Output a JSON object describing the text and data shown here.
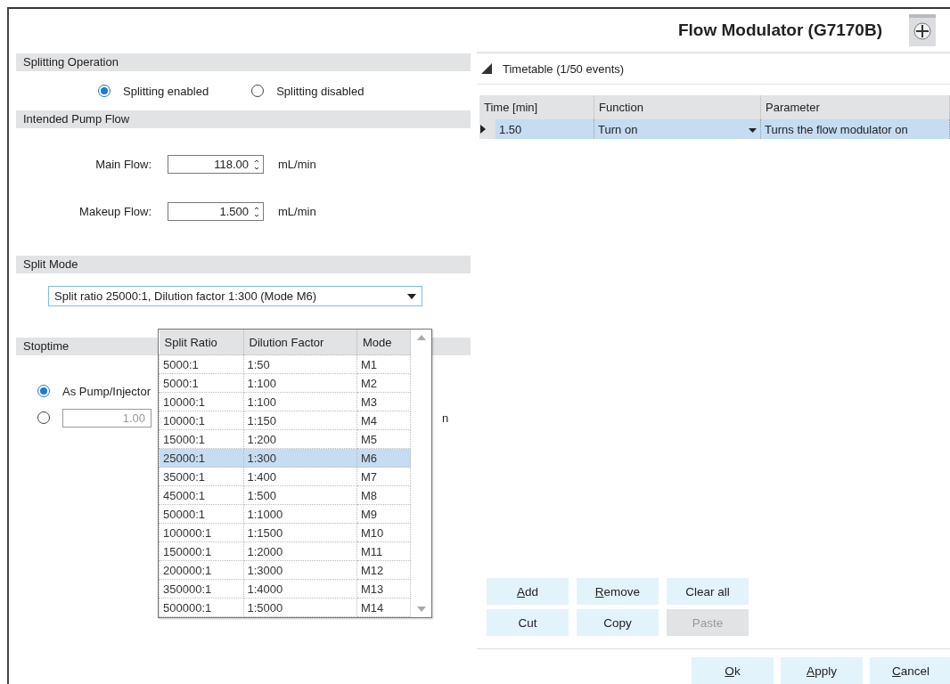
{
  "title": "Flow Modulator (G7170B)",
  "splitting_operation": {
    "heading": "Splitting Operation",
    "options": [
      {
        "label": "Splitting enabled",
        "selected": true
      },
      {
        "label": "Splitting disabled",
        "selected": false
      }
    ]
  },
  "intended_pump_flow": {
    "heading": "Intended Pump Flow",
    "fields": [
      {
        "label": "Main Flow:",
        "value": "118.00",
        "unit": "mL/min"
      },
      {
        "label": "Makeup Flow:",
        "value": "1.500",
        "unit": "mL/min"
      }
    ]
  },
  "split_mode": {
    "heading": "Split Mode",
    "value": "Split ratio 25000:1, Dilution factor 1:300 (Mode M6)",
    "columns": [
      "Split Ratio",
      "Dilution Factor",
      "Mode"
    ],
    "rows": [
      {
        "cells": [
          "5000:1",
          "1:50",
          "M1"
        ],
        "selected": false
      },
      {
        "cells": [
          "5000:1",
          "1:100",
          "M2"
        ],
        "selected": false
      },
      {
        "cells": [
          "10000:1",
          "1:100",
          "M3"
        ],
        "selected": false
      },
      {
        "cells": [
          "10000:1",
          "1:150",
          "M4"
        ],
        "selected": false
      },
      {
        "cells": [
          "15000:1",
          "1:200",
          "M5"
        ],
        "selected": false
      },
      {
        "cells": [
          "25000:1",
          "1:300",
          "M6"
        ],
        "selected": true
      },
      {
        "cells": [
          "35000:1",
          "1:400",
          "M7"
        ],
        "selected": false
      },
      {
        "cells": [
          "45000:1",
          "1:500",
          "M8"
        ],
        "selected": false
      },
      {
        "cells": [
          "50000:1",
          "1:1000",
          "M9"
        ],
        "selected": false
      },
      {
        "cells": [
          "100000:1",
          "1:1500",
          "M10"
        ],
        "selected": false
      },
      {
        "cells": [
          "150000:1",
          "1:2000",
          "M11"
        ],
        "selected": false
      },
      {
        "cells": [
          "200000:1",
          "1:3000",
          "M12"
        ],
        "selected": false
      },
      {
        "cells": [
          "350000:1",
          "1:4000",
          "M13"
        ],
        "selected": false
      },
      {
        "cells": [
          "500000:1",
          "1:5000",
          "M14"
        ],
        "selected": false
      }
    ]
  },
  "stoptime": {
    "heading": "Stoptime",
    "options": [
      {
        "label": "As Pump/Injector",
        "selected": true
      },
      {
        "value": "1.00",
        "unit_visible": "n",
        "selected": false,
        "disabled": true
      }
    ]
  },
  "timetable": {
    "title": "Timetable (1/50 events)",
    "expanded": true,
    "columns": [
      "Time [min]",
      "Function",
      "Parameter"
    ],
    "rows": [
      {
        "cells": [
          "1.50",
          "Turn on",
          "Turns the flow modulator on"
        ],
        "selected": true
      }
    ]
  },
  "table_buttons": [
    {
      "label": "Add",
      "mnemonic": true,
      "disabled": false
    },
    {
      "label": "Remove",
      "mnemonic": true,
      "disabled": false
    },
    {
      "label": "Clear all",
      "mnemonic": false,
      "disabled": false
    },
    {
      "label": "Cut",
      "mnemonic": false,
      "disabled": false
    },
    {
      "label": "Copy",
      "mnemonic": false,
      "disabled": false
    },
    {
      "label": "Paste",
      "mnemonic": false,
      "disabled": true
    }
  ],
  "dialog_buttons": [
    {
      "label": "Ok",
      "mnemonic": true
    },
    {
      "label": "Apply",
      "mnemonic": true
    },
    {
      "label": "Cancel",
      "mnemonic": true
    }
  ]
}
